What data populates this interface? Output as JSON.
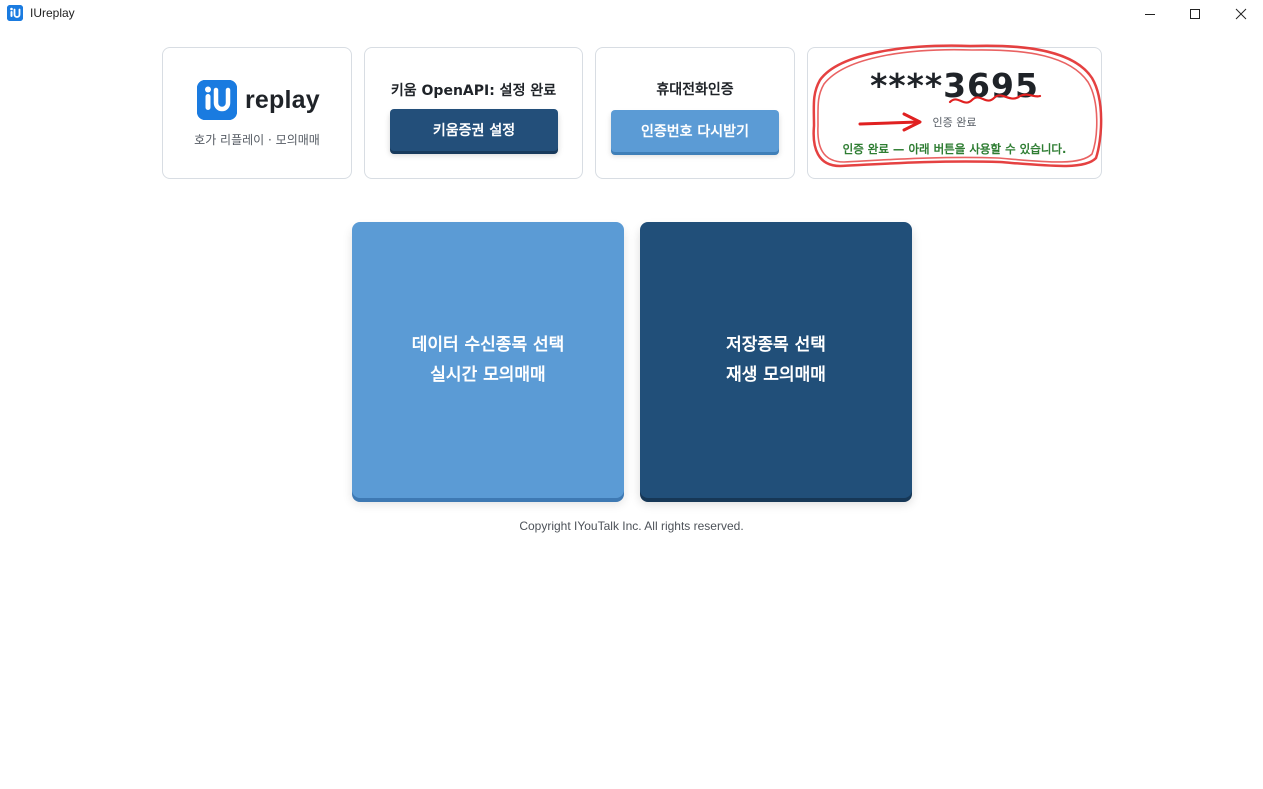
{
  "window": {
    "title": "IUreplay",
    "icon": "app-logo-icon",
    "controls": [
      "minimize-icon",
      "maximize-icon",
      "close-icon"
    ]
  },
  "logo_card": {
    "logo_text": "replay",
    "subtitle": "호가 리플레이 · 모의매매",
    "icon": "iu-logo-icon"
  },
  "kiwoom_card": {
    "title": "키움 OpenAPI: 설정 완료",
    "button_label": "키움증권 설정"
  },
  "phone_card": {
    "title": "휴대전화인증",
    "button_label": "인증번호 다시받기"
  },
  "status_card": {
    "masked_number": "****3695",
    "status": "인증 완료",
    "message": "인증 완료 — 아래 버튼을 사용할 수 있습니다."
  },
  "tiles": {
    "live": {
      "line1": "데이터 수신종목 선택",
      "line2": "실시간 모의매매"
    },
    "replay": {
      "line1": "저장종목 선택",
      "line2": "재생 모의매매"
    }
  },
  "footer": {
    "copyright": "Copyright IYouTalk Inc. All rights reserved."
  },
  "colors": {
    "accent_light": "#5b9bd5",
    "accent_dark": "#214f79",
    "success_text": "#2e7d32",
    "annotation_red": "#e02020"
  }
}
